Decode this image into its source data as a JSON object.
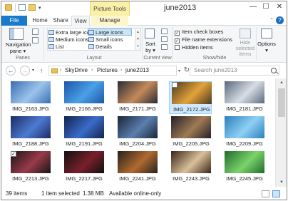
{
  "titlebar": {
    "context_tab": "Picture Tools",
    "title": "june2013",
    "minimize": "—",
    "maximize": "☐",
    "close": "✕",
    "qa_dropdown": "▾"
  },
  "tabs": {
    "file": "File",
    "home": "Home",
    "share": "Share",
    "view": "View",
    "manage": "Manage",
    "help": "?",
    "ribbon_toggle": "⌃"
  },
  "ribbon": {
    "panes": {
      "navigation_pane": "Navigation pane ▾",
      "group_label": "Panes"
    },
    "layout": {
      "extra_large_icons": "Extra large icons",
      "large_icons": "Large icons",
      "medium_icons": "Medium icons",
      "small_icons": "Small icons",
      "list": "List",
      "details": "Details",
      "group_label": "Layout"
    },
    "current_view": {
      "sort_by": "Sort by ▾",
      "group_label": "Current view"
    },
    "show_hide": {
      "item_check_boxes": "Item check boxes",
      "file_name_extensions": "File name extensions",
      "hidden_items": "Hidden items",
      "check_mark": "✓",
      "hide_selected_items": "Hide selected items",
      "group_label": "Show/hide"
    },
    "options": "Options ▾"
  },
  "address": {
    "back": "←",
    "forward": "→",
    "recent": "▾",
    "up": "↑",
    "separator": "›",
    "breadcrumbs": [
      "SkyDrive",
      "Pictures",
      "june2013"
    ],
    "dropdown": "▾",
    "refresh": "↻",
    "search_placeholder": "Search june2013"
  },
  "files": [
    {
      "name": "IMG_2163.JPG",
      "selected": false,
      "checked": false,
      "colors": [
        "#3a6fb5",
        "#9cc3ea"
      ]
    },
    {
      "name": "IMG_2166.JPG",
      "selected": false,
      "checked": false,
      "colors": [
        "#1e55a8",
        "#4aa0e6"
      ]
    },
    {
      "name": "IMG_2171.JPG",
      "selected": false,
      "checked": false,
      "colors": [
        "#2a2a35",
        "#c48a5a"
      ]
    },
    {
      "name": "IMG_2172.JPG",
      "selected": true,
      "checked": false,
      "colors": [
        "#4a3a22",
        "#e3a23b"
      ]
    },
    {
      "name": "IMG_2181.JPG",
      "selected": false,
      "checked": false,
      "colors": [
        "#5a6a7a",
        "#d6dde6"
      ]
    },
    {
      "name": "IMG_2188.JPG",
      "selected": false,
      "checked": false,
      "colors": [
        "#1d2a66",
        "#4d7bd1"
      ]
    },
    {
      "name": "IMG_2191.JPG",
      "selected": false,
      "checked": false,
      "colors": [
        "#13224f",
        "#3a6cc8"
      ]
    },
    {
      "name": "IMG_2204.JPG",
      "selected": false,
      "checked": false,
      "colors": [
        "#1b2436",
        "#5b7fae"
      ]
    },
    {
      "name": "IMG_2205.JPG",
      "selected": false,
      "checked": false,
      "colors": [
        "#20202a",
        "#a07a52"
      ]
    },
    {
      "name": "IMG_2209.JPG",
      "selected": false,
      "checked": false,
      "colors": [
        "#2b7fbf",
        "#8fd0f2"
      ]
    },
    {
      "name": "IMG_2213.JPG",
      "selected": false,
      "checked": true,
      "colors": [
        "#151515",
        "#9a3a4a"
      ]
    },
    {
      "name": "IMG_2217.JPG",
      "selected": false,
      "checked": false,
      "colors": [
        "#101010",
        "#7a1f2a"
      ]
    },
    {
      "name": "IMG_2241.JPG",
      "selected": false,
      "checked": false,
      "colors": [
        "#25201d",
        "#b06a2f"
      ]
    },
    {
      "name": "IMG_2243.JPG",
      "selected": false,
      "checked": false,
      "colors": [
        "#3a2418",
        "#d9c09a"
      ]
    },
    {
      "name": "IMG_2245.JPG",
      "selected": false,
      "checked": false,
      "colors": [
        "#1f6b2c",
        "#7bd36a"
      ]
    }
  ],
  "scrollbar": {
    "up": "▲",
    "down": "▼"
  },
  "status": {
    "item_count": "39 items",
    "selection": "1 item selected",
    "size": "1.38 MB",
    "availability": "Available online-only"
  }
}
